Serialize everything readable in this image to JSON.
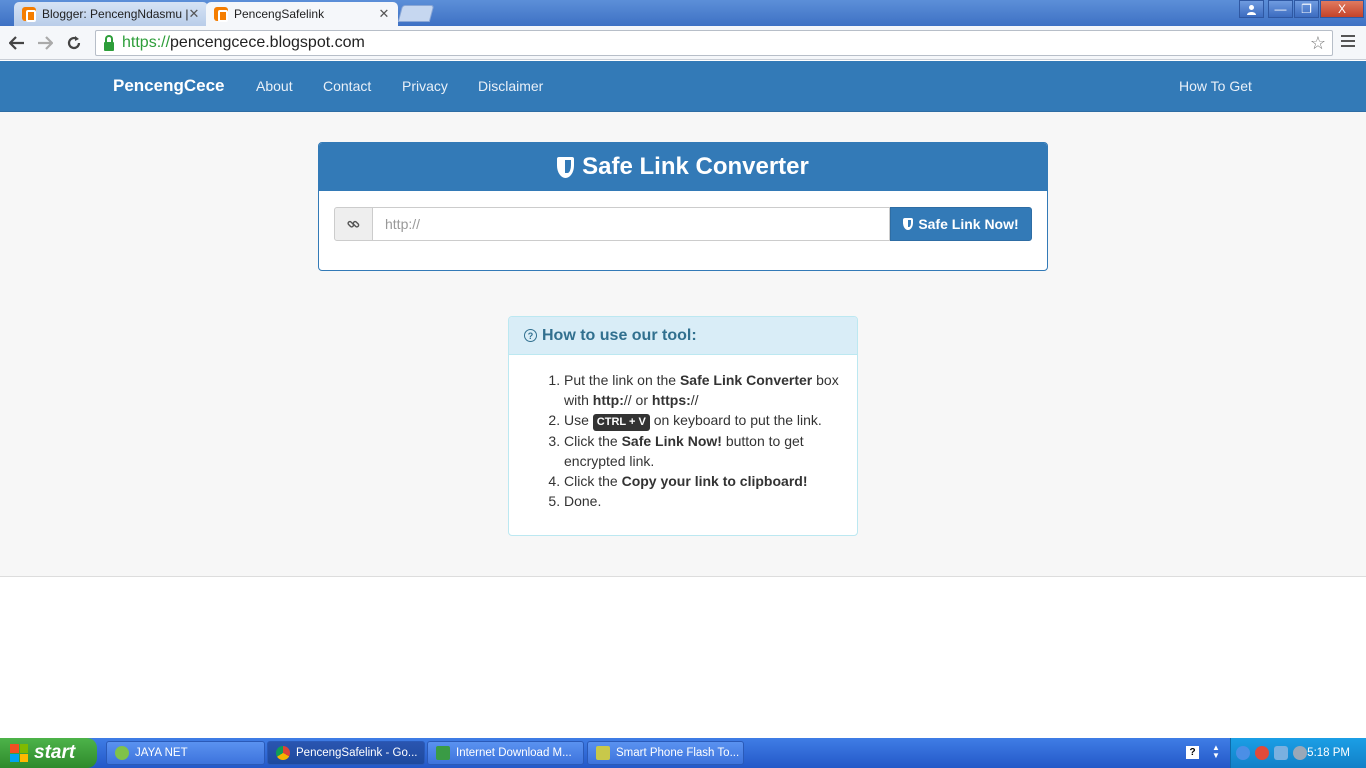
{
  "browser": {
    "tabs": [
      {
        "label": "Blogger: PencengNdasmu | S",
        "active": false
      },
      {
        "label": "PencengSafelink",
        "active": true
      }
    ],
    "tab_close_glyph": "✕",
    "window_controls": {
      "minimize": "—",
      "maximize": "❐",
      "close": "X"
    },
    "address": {
      "scheme": "https://",
      "host": "pencengcece.blogspot.com"
    },
    "icons": {
      "back": "back-arrow-icon",
      "forward": "forward-arrow-icon",
      "reload": "reload-icon",
      "lock": "lock-icon",
      "star": "star-icon",
      "menu": "hamburger-menu-icon"
    }
  },
  "navbar": {
    "brand": "PencengCece",
    "links": [
      "About",
      "Contact",
      "Privacy",
      "Disclaimer"
    ],
    "right_link": "How To Get",
    "color": "#337ab7"
  },
  "converter": {
    "title": "Safe Link Converter",
    "input_placeholder": "http://",
    "input_value": "",
    "button_label": "Safe Link Now!",
    "addon_icon": "link-icon"
  },
  "howto": {
    "title": "How to use our tool:",
    "steps": {
      "s1": {
        "a": "Put the link on the ",
        "b": "Safe Link Converter",
        "c": " box with ",
        "d": "http:",
        "e": "// or ",
        "f": "https:",
        "g": "//"
      },
      "s2": {
        "a": "Use ",
        "kbd": "CTRL + V",
        "c": " on keyboard to put the link."
      },
      "s3": {
        "a": "Click the ",
        "b": "Safe Link Now!",
        "c": " button to get encrypted link."
      },
      "s4": {
        "a": "Click the ",
        "b": "Copy your link to clipboard!"
      },
      "s5": {
        "a": "Done."
      }
    }
  },
  "taskbar": {
    "start_label": "start",
    "tasks": [
      "JAYA NET",
      "PencengSafelink - Go...",
      "Internet Download M...",
      "Smart Phone Flash To..."
    ],
    "clock": "5:18 PM",
    "help_glyph": "?"
  }
}
